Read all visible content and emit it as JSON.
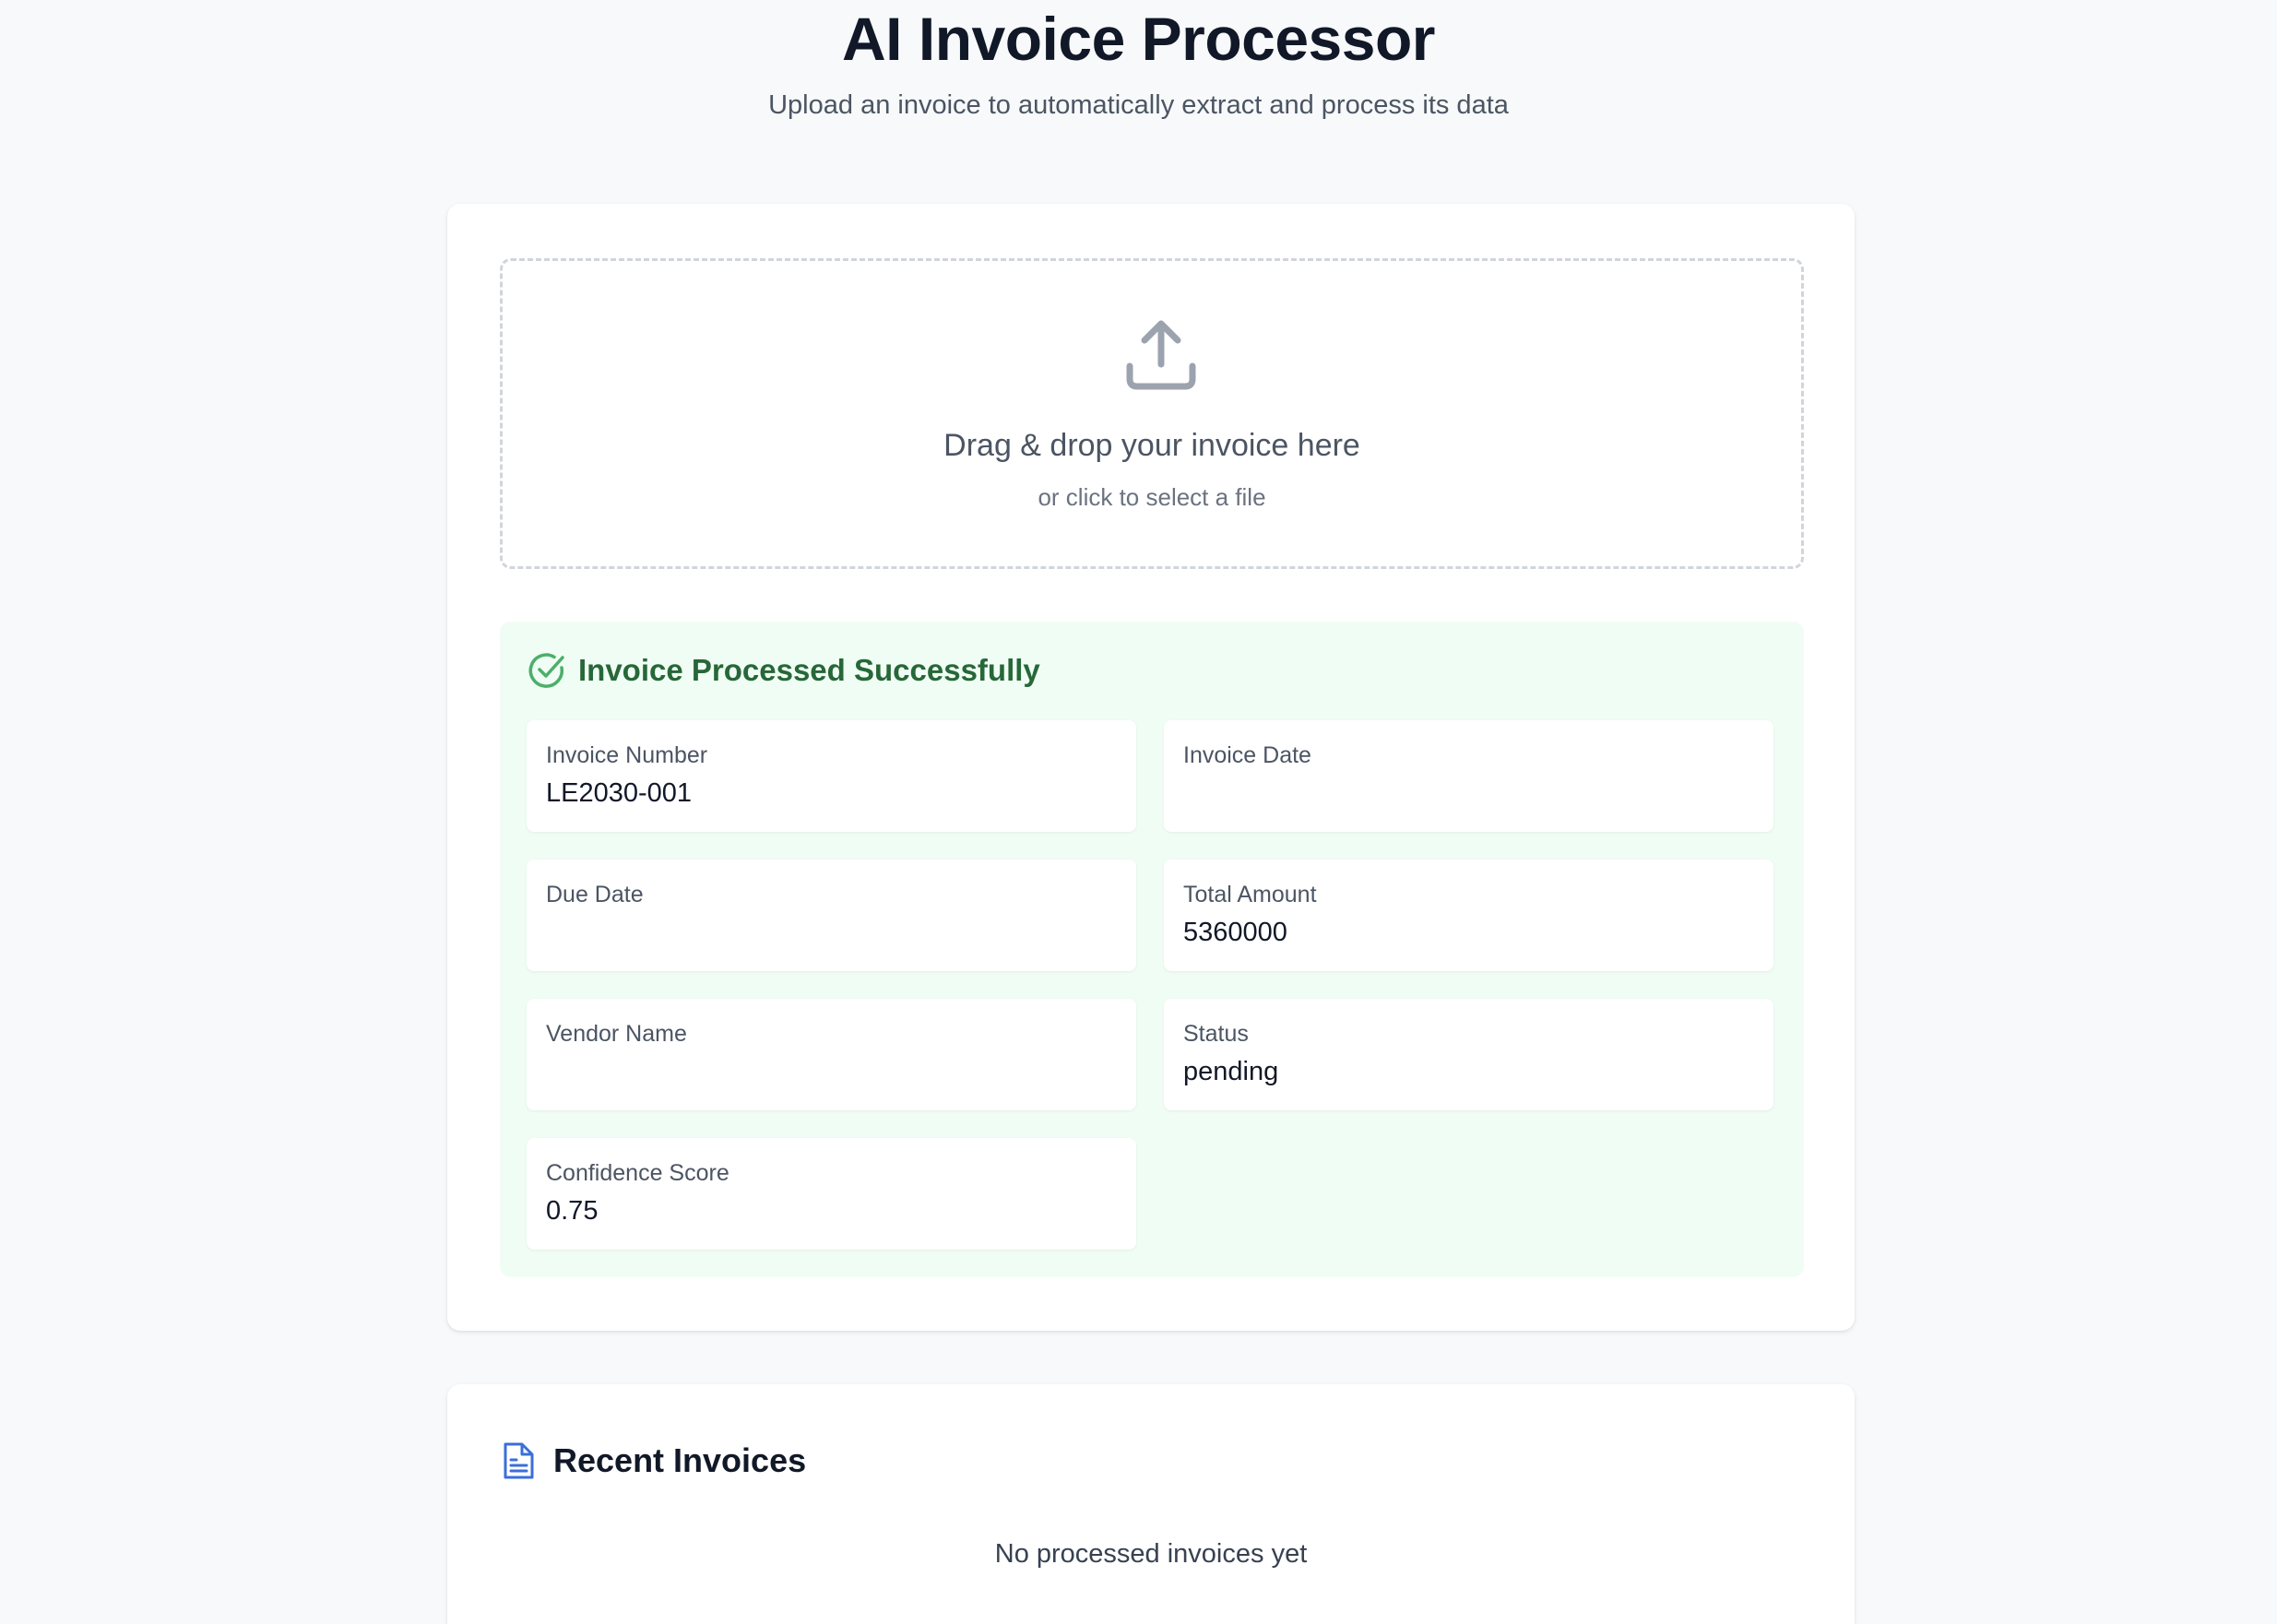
{
  "header": {
    "title": "AI Invoice Processor",
    "subtitle": "Upload an invoice to automatically extract and process its data"
  },
  "dropzone": {
    "icon": "upload-icon",
    "title": "Drag & drop your invoice here",
    "subtitle": "or click to select a file"
  },
  "result": {
    "icon": "check-circle-icon",
    "title": "Invoice Processed Successfully",
    "fields": [
      {
        "label": "Invoice Number",
        "value": "LE2030-001"
      },
      {
        "label": "Invoice Date",
        "value": ""
      },
      {
        "label": "Due Date",
        "value": ""
      },
      {
        "label": "Total Amount",
        "value": "5360000"
      },
      {
        "label": "Vendor Name",
        "value": ""
      },
      {
        "label": "Status",
        "value": "pending"
      },
      {
        "label": "Confidence Score",
        "value": "0.75"
      }
    ]
  },
  "recent": {
    "icon": "document-icon",
    "title": "Recent Invoices",
    "empty_text": "No processed invoices yet"
  },
  "colors": {
    "background": "#f8f9fb",
    "success_bg": "#f0fdf4",
    "success_text": "#276738",
    "success_icon": "#4caf6a",
    "accent_blue": "#3b6fd8",
    "icon_gray": "#9ca3af"
  }
}
